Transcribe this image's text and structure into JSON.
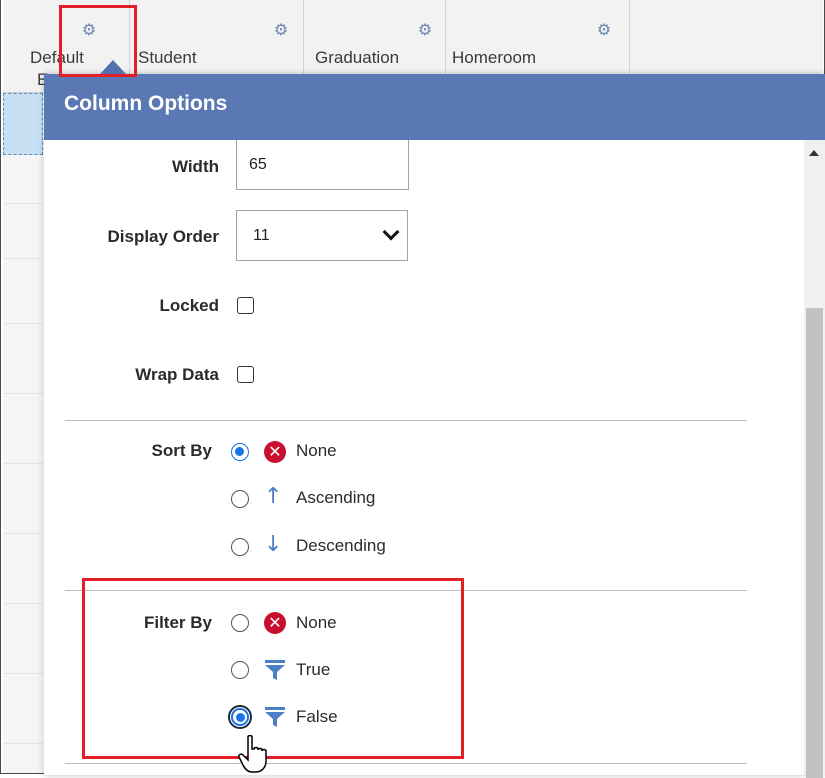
{
  "grid": {
    "columns": [
      {
        "label": "Default",
        "sub": "E",
        "gear_icon": "gear-icon"
      },
      {
        "label": "Student",
        "gear_icon": "gear-icon"
      },
      {
        "label": "Graduation",
        "gear_icon": "gear-icon"
      },
      {
        "label": "Homeroom",
        "gear_icon": "gear-icon"
      }
    ]
  },
  "popup": {
    "title": "Column Options",
    "width_label": "Width",
    "width_value": "65",
    "display_order_label": "Display Order",
    "display_order_value": "11",
    "locked_label": "Locked",
    "locked_checked": false,
    "wrap_label": "Wrap Data",
    "wrap_checked": false,
    "sort_by_label": "Sort By",
    "sort_options": [
      {
        "label": "None",
        "icon": "x-circle-icon",
        "selected": true
      },
      {
        "label": "Ascending",
        "icon": "arrow-up-icon",
        "selected": false
      },
      {
        "label": "Descending",
        "icon": "arrow-down-icon",
        "selected": false
      }
    ],
    "filter_by_label": "Filter By",
    "filter_options": [
      {
        "label": "None",
        "icon": "x-circle-icon",
        "selected": false
      },
      {
        "label": "True",
        "icon": "funnel-icon",
        "selected": false
      },
      {
        "label": "False",
        "icon": "funnel-icon",
        "selected": true
      }
    ]
  },
  "colors": {
    "title_bar": "#5a78b4",
    "highlight": "#e21f26",
    "radio_selected": "#1a73e8",
    "x_icon": "#c8102e",
    "funnel": "#4d7fc4"
  }
}
